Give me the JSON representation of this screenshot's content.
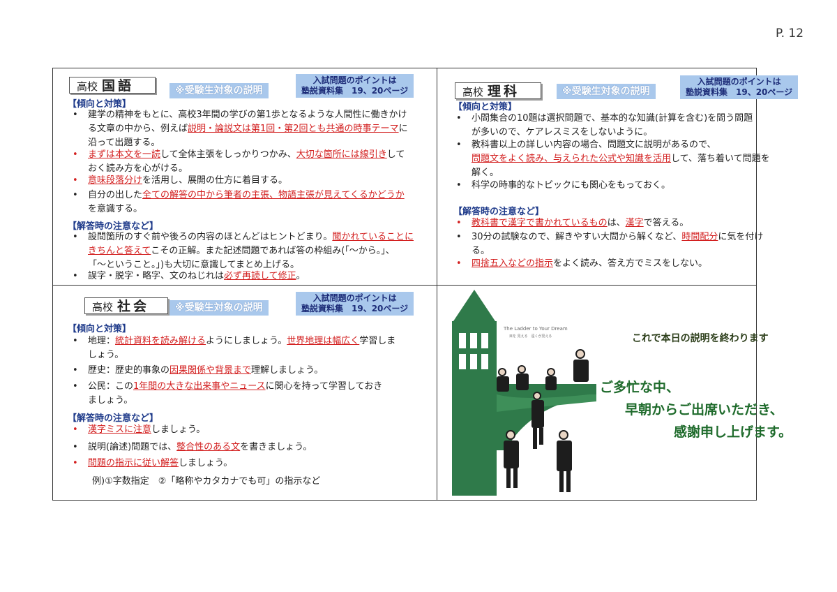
{
  "page_number": "P. 12",
  "japanese": {
    "subject_prefix": "高校",
    "subject_name": "国語",
    "exam_tag": "※受験生対象の説明",
    "points_line1": "入試問題のポイントは",
    "points_line2": "塾説資料集　19、20ページ",
    "trend_heading": "【傾向と対策】",
    "b1_l1a": "建学の精神をもとに、高校3年間の学びの第1歩となるような人間性に働きかけ",
    "b1_l2a": "る文章の中から、例えば",
    "b1_l2r": "説明・論説文は第1回・第2回とも共通の時事テーマ",
    "b1_l2b": "に",
    "b1_l3a": "沿って出題する。",
    "b2_l1r1": "まずは本文を一読",
    "b2_l1a": "して全体主張をしっかりつかみ、",
    "b2_l1r2": "大切な箇所には線引き",
    "b2_l1b": "して",
    "b2_l2a": "おく読み方を心がける。",
    "b3_l1r": "意味段落分け",
    "b3_l1a": "を活用し、展開の仕方に着目する。",
    "b4_l1a": "自分の出した",
    "b4_l1r": "全ての解答の中から筆者の主張、物語主張が見えてくるかどうか",
    "b4_l2a": "を意識する。",
    "answer_heading": "【解答時の注意など】",
    "a1_l1a": "設問箇所のすぐ前や後ろの内容のほとんどはヒントどまり。",
    "a1_l1r": "聞かれていることに",
    "a1_l2r": "きちんと答えて",
    "a1_l2a": "こその正解。また記述問題であれば答の枠組み(「～から。」、",
    "a1_l3a": "「～ということ。」)も大切に意識してまとめ上げる。",
    "a2_l1a": "誤字・脱字・略字、文のねじれは",
    "a2_l1r": "必ず再読して修正",
    "a2_l1b": "。"
  },
  "science": {
    "subject_prefix": "高校",
    "subject_name": "理科",
    "exam_tag": "※受験生対象の説明",
    "points_line1": "入試問題のポイントは",
    "points_line2": "塾説資料集　19、20ページ",
    "trend_heading": "【傾向と対策】",
    "b1_l1a": "小問集合の10題は選択問題で、基本的な知識(計算を含む)を問う問題",
    "b1_l2a": "が多いので、ケアレスミスをしないように。",
    "b2_l1a": "教科書以上の詳しい内容の場合、問題文に説明があるので、",
    "b2_l2r": "問題文をよく読み、与えられた公式や知識を活用",
    "b2_l2a": "して、落ち着いて問題を",
    "b2_l3a": "解く。",
    "b3_l1a": "科学の時事的なトピックにも関心をもっておく。",
    "answer_heading": "【解答時の注意など】",
    "a1_l1r1": "教科書で漢字で書かれているもの",
    "a1_l1a": "は、",
    "a1_l1r2": "漢字",
    "a1_l1b": "で答える。",
    "a2_l1a": "30分の試験なので、解きやすい大問から解くなど、",
    "a2_l1r": "時間配分",
    "a2_l1b": "に気を付け",
    "a2_l2a": "る。",
    "a3_l1r": "四捨五入などの指示",
    "a3_l1a": "をよく読み、答え方でミスをしない。"
  },
  "social": {
    "subject_prefix": "高校",
    "subject_name": "社会",
    "exam_tag": "※受験生対象の説明",
    "points_line1": "入試問題のポイントは",
    "points_line2": "塾説資料集　19、20ページ",
    "trend_heading": "【傾向と対策】",
    "b1_l1a": "地理：",
    "b1_l1r1": "統計資料を読み解ける",
    "b1_l1b": "ようにしましょう。",
    "b1_l1r2": "世界地理は幅広く",
    "b1_l1c": "学習しま",
    "b1_l2a": "しょう。",
    "b2_l1a": "歴史：歴史的事象の",
    "b2_l1r": "因果関係や背景まで",
    "b2_l1b": "理解しましょう。",
    "b3_l1a": "公民：この",
    "b3_l1r": "1年間の大きな出来事やニュース",
    "b3_l1b": "に関心を持って学習しておき",
    "b3_l2a": "ましょう。",
    "answer_heading": "【解答時の注意など】",
    "a1_l1r": "漢字ミスに注意",
    "a1_l1a": "しましょう。",
    "a2_l1a": "説明(論述)問題では、",
    "a2_l1r": "整合性のある文",
    "a2_l1b": "を書きましょう。",
    "a3_l1r": "問題の指示に従い解答",
    "a3_l1a": "しましょう。",
    "example": "例)①字数指定　②「略称やカタカナでも可」の指示など"
  },
  "closing": {
    "title": "これで本日の説明を終わります",
    "line1": "ご多忙な中、",
    "line2": "早朝からご出席いただき、",
    "line3": "感謝申し上げます。",
    "tagline": "The Ladder to Your Dream",
    "tagline_sub": "目を 見える　遠くが見える"
  },
  "colors": {
    "heading_blue": "#1e3a8a",
    "emphasis_red": "#d32020",
    "tag_blue": "#a9c8ec",
    "tower_green": "#2f7a4a",
    "closing_green": "#1f6b2c"
  }
}
